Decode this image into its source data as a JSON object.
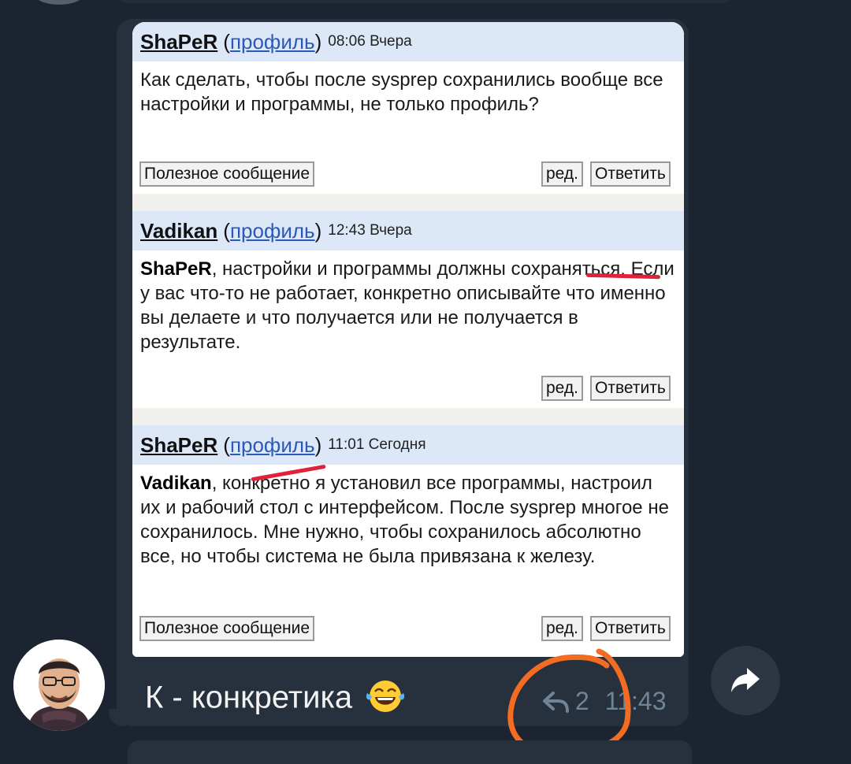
{
  "posts": [
    {
      "author": "ShaPeR",
      "profile_link": "профиль",
      "time": "08:06 Вчера",
      "mention": "",
      "body": "Как сделать, чтобы после sysprep сохранились вообще все настройки и программы, не только профиль?",
      "useful_label": "Полезное сообщение",
      "edit_label": "ред.",
      "reply_label": "Ответить"
    },
    {
      "author": "Vadikan",
      "profile_link": "профиль",
      "time": "12:43 Вчера",
      "mention": "ShaPeR",
      "body": ", настройки и программы должны сохраняться. Если у вас что-то не работает, конкретно описывайте что именно вы делаете и что получается или не получается в результате.",
      "edit_label": "ред.",
      "reply_label": "Ответить"
    },
    {
      "author": "ShaPeR",
      "profile_link": "профиль",
      "time": "11:01 Сегодня",
      "mention": "Vadikan",
      "body": ", конкретно я установил все программы, настроил их и рабочий стол с интерфейсом. После sysprep многое не сохранилось. Мне нужно, чтобы сохранилось абсолютно все, но чтобы система не была привязана к железу.",
      "useful_label": "Полезное сообщение",
      "edit_label": "ред.",
      "reply_label": "Ответить"
    }
  ],
  "message": {
    "caption": "К - конкретика",
    "emoji": "face-with-tears-of-joy",
    "reply_count": "2",
    "time": "11:43"
  },
  "icons": {
    "reply": "reply-arrow-icon",
    "forward": "forward-arrow-icon"
  },
  "colors": {
    "background": "#1b2430",
    "bubble": "#26313d",
    "post_header": "#dce8f8",
    "link": "#2a59b8",
    "annotation_red": "#e0213a",
    "annotation_orange": "#f36c21"
  }
}
